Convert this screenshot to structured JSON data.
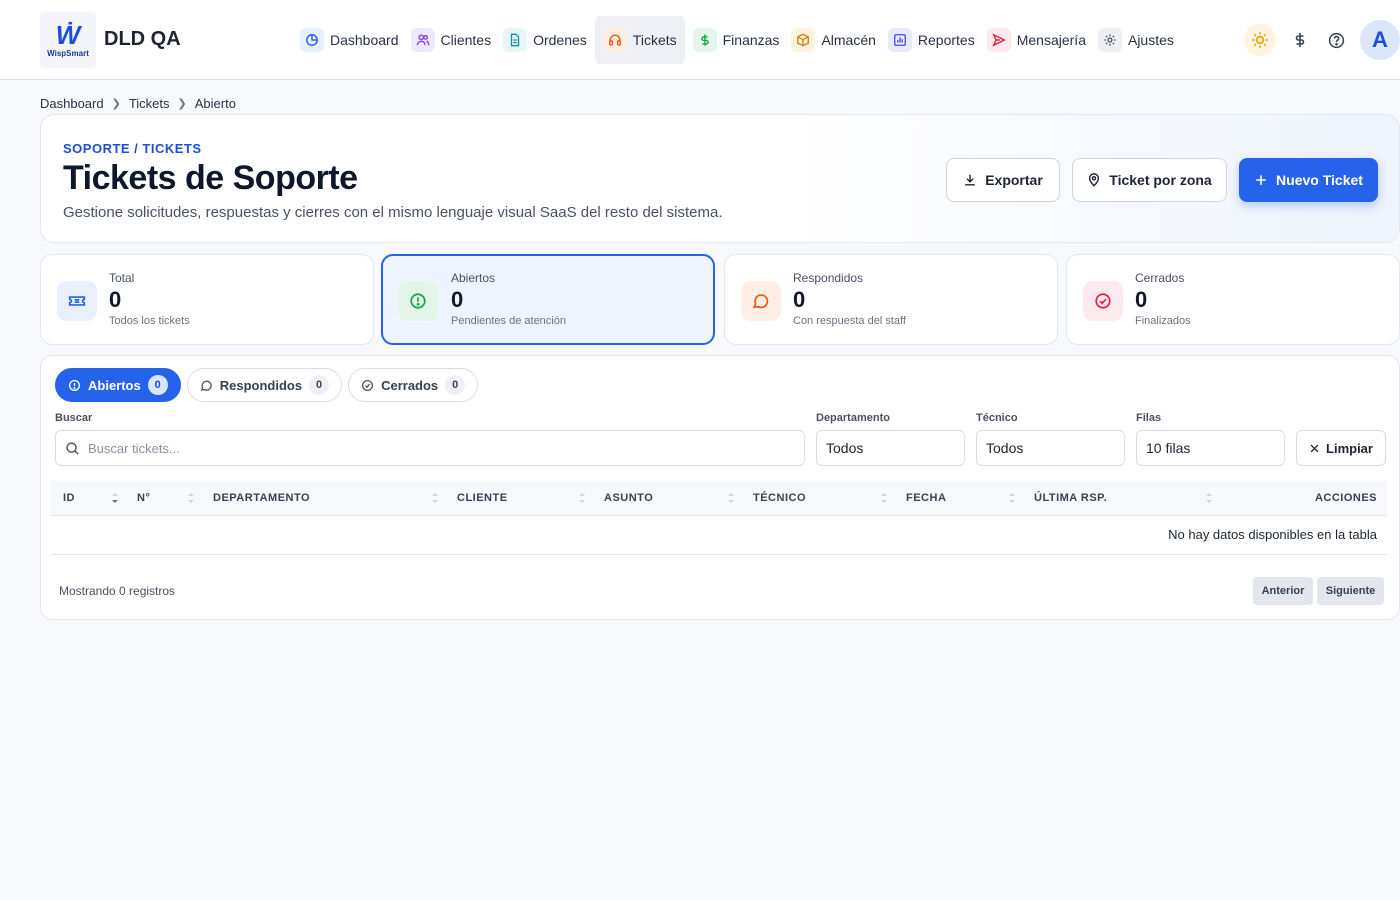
{
  "app": {
    "logo_text": "WispSmart",
    "name": "DLD QA"
  },
  "nav": [
    {
      "label": "Dashboard",
      "icon": "dashboard-icon",
      "color": "#2563eb",
      "bg": "#e8effd"
    },
    {
      "label": "Clientes",
      "icon": "users-icon",
      "color": "#7c3aed",
      "bg": "#efe9fd"
    },
    {
      "label": "Ordenes",
      "icon": "file-icon",
      "color": "#0891b2",
      "bg": "#e6f6f9"
    },
    {
      "label": "Tickets",
      "icon": "headset-icon",
      "color": "#ea580c",
      "bg": "#fdeee4"
    },
    {
      "label": "Finanzas",
      "icon": "dollar-icon",
      "color": "#16a34a",
      "bg": "#e6f6ec"
    },
    {
      "label": "Almacén",
      "icon": "box-icon",
      "color": "#d97706",
      "bg": "#fdf3e0"
    },
    {
      "label": "Reportes",
      "icon": "chart-icon",
      "color": "#4f46e5",
      "bg": "#eaeafd"
    },
    {
      "label": "Mensajería",
      "icon": "send-icon",
      "color": "#e11d48",
      "bg": "#fde8ec"
    },
    {
      "label": "Ajustes",
      "icon": "gear-icon",
      "color": "#4b5563",
      "bg": "#eef0f4"
    }
  ],
  "user": {
    "avatar_letter": "A"
  },
  "breadcrumb": [
    "Dashboard",
    "Tickets",
    "Abierto"
  ],
  "header": {
    "eyebrow": "SOPORTE / TICKETS",
    "title": "Tickets de Soporte",
    "subtitle": "Gestione solicitudes, respuestas y cierres con el mismo lenguaje visual SaaS del resto del sistema.",
    "export_label": "Exportar",
    "zone_label": "Ticket por zona",
    "new_label": "Nuevo Ticket"
  },
  "stats": [
    {
      "label": "Total",
      "value": "0",
      "note": "Todos los tickets",
      "color": "#2563eb",
      "bg": "#e8effd"
    },
    {
      "label": "Abiertos",
      "value": "0",
      "note": "Pendientes de atención",
      "color": "#16a34a",
      "bg": "#e3f5e9"
    },
    {
      "label": "Respondidos",
      "value": "0",
      "note": "Con respuesta del staff",
      "color": "#ea580c",
      "bg": "#fdefe6"
    },
    {
      "label": "Cerrados",
      "value": "0",
      "note": "Finalizados",
      "color": "#e11d48",
      "bg": "#fdeaee"
    }
  ],
  "tabs": [
    {
      "label": "Abiertos",
      "count": "0"
    },
    {
      "label": "Respondidos",
      "count": "0"
    },
    {
      "label": "Cerrados",
      "count": "0"
    }
  ],
  "filters": {
    "search_label": "Buscar",
    "search_placeholder": "Buscar tickets...",
    "dept_label": "Departamento",
    "dept_value": "Todos",
    "tech_label": "Técnico",
    "tech_value": "Todos",
    "rows_label": "Filas",
    "rows_value": "10 filas",
    "clear_label": "Limpiar"
  },
  "table": {
    "columns": [
      "ID",
      "N°",
      "DEPARTAMENTO",
      "CLIENTE",
      "ASUNTO",
      "TÉCNICO",
      "FECHA",
      "ÚLTIMA RSP.",
      "ACCIONES"
    ],
    "empty_text": "No hay datos disponibles en la tabla",
    "footer_text": "Mostrando 0 registros",
    "prev_label": "Anterior",
    "next_label": "Siguiente"
  }
}
